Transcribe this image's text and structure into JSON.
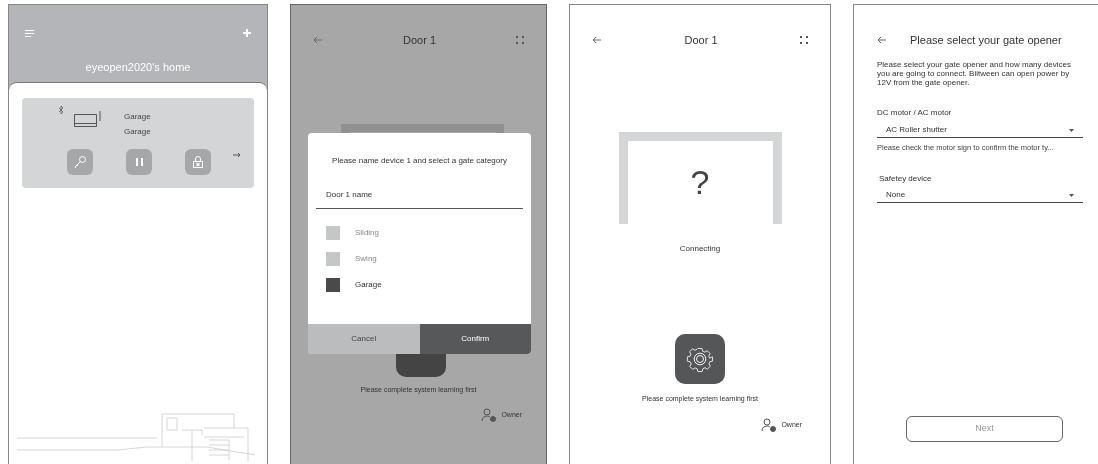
{
  "home": {
    "title": "eyeopen2020's home",
    "device": {
      "name": "Garage",
      "type": "Garage"
    }
  },
  "door_dialog": {
    "title": "Door 1",
    "prompt": "Please name device 1 and select a gate category",
    "name_placeholder": "Door 1 name",
    "categories": [
      {
        "label": "Sliding",
        "selected": false
      },
      {
        "label": "Swing",
        "selected": false
      },
      {
        "label": "Garage",
        "selected": true
      }
    ],
    "cancel": "Cancel",
    "confirm": "Confirm",
    "hint": "Please complete system learning first",
    "role": "Owner"
  },
  "door_connecting": {
    "title": "Door 1",
    "status_symbol": "?",
    "status": "Connecting",
    "hint": "Please complete system learning first",
    "role": "Owner"
  },
  "gate_opener": {
    "title": "Please select your gate opener",
    "description": "Please select your gate opener and how many devices you are going to connect. Biitween can open power by 12V from the gate opener.",
    "motor": {
      "label": "DC motor / AC motor",
      "value": "AC Roller shutter",
      "note": "Please check the motor sign to confirm the motor ty..."
    },
    "safety": {
      "label": "Safetey device",
      "value": "None"
    },
    "next": "Next"
  }
}
